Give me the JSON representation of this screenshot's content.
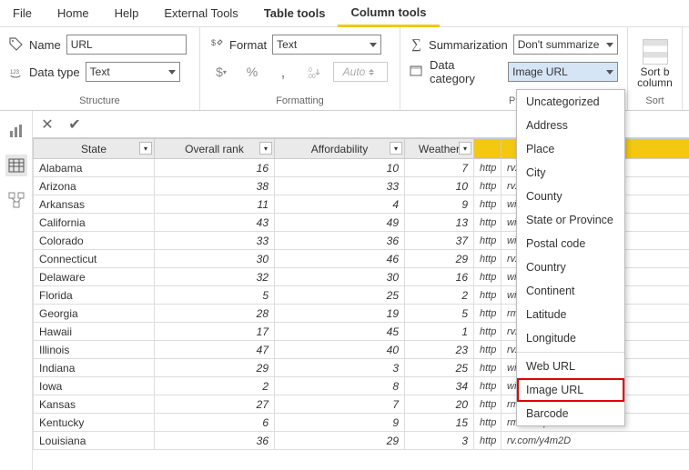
{
  "tabs": {
    "file": "File",
    "home": "Home",
    "help": "Help",
    "external": "External Tools",
    "table": "Table tools",
    "column": "Column tools"
  },
  "ribbon": {
    "name_label": "Name",
    "name_value": "URL",
    "datatype_label": "Data type",
    "datatype_value": "Text",
    "format_label": "Format",
    "format_value": "Text",
    "auto": "Auto",
    "summ_label": "Summarization",
    "summ_value": "Don't summarize",
    "cat_label": "Data category",
    "cat_value": "Image URL",
    "sort_label": "Sort b",
    "sort_label2": "column",
    "groups": {
      "structure": "Structure",
      "formatting": "Formatting",
      "prop": "Pr",
      "sort": "Sort"
    }
  },
  "table": {
    "headers": [
      "State",
      "Overall rank",
      "Affordability",
      "Weather",
      "",
      ""
    ],
    "rows": [
      {
        "state": "Alabama",
        "rank": 16,
        "aff": 10,
        "wea": 7,
        "u": "http",
        "ur": "rv.com/y4meX"
      },
      {
        "state": "Arizona",
        "rank": 38,
        "aff": 33,
        "wea": 10,
        "u": "http",
        "ur": "rv.com/y4m2D"
      },
      {
        "state": "Arkansas",
        "rank": 11,
        "aff": 4,
        "wea": 9,
        "u": "http",
        "ur": "wikipedia/com"
      },
      {
        "state": "California",
        "rank": 43,
        "aff": 49,
        "wea": 13,
        "u": "http",
        "ur": "wikipedia/com"
      },
      {
        "state": "Colorado",
        "rank": 33,
        "aff": 36,
        "wea": 37,
        "u": "http",
        "ur": "wikipedia/com"
      },
      {
        "state": "Connecticut",
        "rank": 30,
        "aff": 46,
        "wea": 29,
        "u": "http",
        "ur": "rv.com/y4m2D"
      },
      {
        "state": "Delaware",
        "rank": 32,
        "aff": 30,
        "wea": 16,
        "u": "http",
        "ur": "wikipedia/com"
      },
      {
        "state": "Florida",
        "rank": 5,
        "aff": 25,
        "wea": 2,
        "u": "http",
        "ur": "wikipedia/com"
      },
      {
        "state": "Georgia",
        "rank": 28,
        "aff": 19,
        "wea": 5,
        "u": "http",
        "ur": "rmat/bmp/sar"
      },
      {
        "state": "Hawaii",
        "rank": 17,
        "aff": 45,
        "wea": 1,
        "u": "http",
        "ur": "rv.com/y4meX"
      },
      {
        "state": "Illinois",
        "rank": 47,
        "aff": 40,
        "wea": 23,
        "u": "http",
        "ur": "rv.com/y4m2D"
      },
      {
        "state": "Indiana",
        "rank": 29,
        "aff": 3,
        "wea": 25,
        "u": "http",
        "ur": "wikipedia/com"
      },
      {
        "state": "Iowa",
        "rank": 2,
        "aff": 8,
        "wea": 34,
        "u": "http",
        "ur": "wikipedia/com"
      },
      {
        "state": "Kansas",
        "rank": 27,
        "aff": 7,
        "wea": 20,
        "u": "http",
        "ur": "rmat/bmp/sar"
      },
      {
        "state": "Kentucky",
        "rank": 6,
        "aff": 9,
        "wea": 15,
        "u": "http",
        "ur": "rmat/bmp/sar"
      },
      {
        "state": "Louisiana",
        "rank": 36,
        "aff": 29,
        "wea": 3,
        "u": "http",
        "ur": "rv.com/y4m2D"
      }
    ]
  },
  "dropdown": {
    "items": [
      {
        "label": "Uncategorized"
      },
      {
        "label": "Address"
      },
      {
        "label": "Place"
      },
      {
        "label": "City"
      },
      {
        "label": "County"
      },
      {
        "label": "State or Province"
      },
      {
        "label": "Postal code"
      },
      {
        "label": "Country"
      },
      {
        "label": "Continent"
      },
      {
        "label": "Latitude"
      },
      {
        "label": "Longitude"
      },
      {
        "label": "Web URL",
        "sep_before": true
      },
      {
        "label": "Image URL",
        "hl": true
      },
      {
        "label": "Barcode"
      }
    ]
  }
}
